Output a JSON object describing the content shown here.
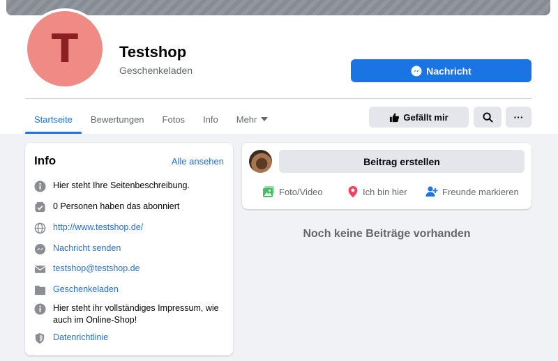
{
  "page": {
    "avatar_letter": "T",
    "title": "Testshop",
    "category": "Geschenkeladen"
  },
  "actions": {
    "message_label": "Nachricht",
    "like_label": "Gefällt mir",
    "more_label": "···"
  },
  "tabs": [
    {
      "label": "Startseite",
      "active": true
    },
    {
      "label": "Bewertungen"
    },
    {
      "label": "Fotos"
    },
    {
      "label": "Info"
    },
    {
      "label": "Mehr"
    }
  ],
  "info": {
    "title": "Info",
    "see_all": "Alle ansehen",
    "items": [
      {
        "icon": "info-icon",
        "text": "Hier steht Ihre Seitenbeschreibung."
      },
      {
        "icon": "subscribe-icon",
        "text": "0 Personen haben das abonniert"
      },
      {
        "icon": "globe-icon",
        "text": "http://www.testshop.de/"
      },
      {
        "icon": "messenger-icon",
        "text": "Nachricht senden"
      },
      {
        "icon": "email-icon",
        "text": "testshop@testshop.de"
      },
      {
        "icon": "category-icon",
        "text": "Geschenkeladen"
      },
      {
        "icon": "info-icon",
        "text": "Hier steht ihr vollständiges Impressum, wie auch im Online-Shop!"
      },
      {
        "icon": "shield-icon",
        "text": "Datenrichtlinie"
      }
    ]
  },
  "composer": {
    "create_label": "Beitrag erstellen",
    "photo_video": "Foto/Video",
    "checkin": "Ich bin hier",
    "tag_friends": "Freunde markieren"
  },
  "feed": {
    "empty_message": "Noch keine Beiträge vorhanden"
  },
  "colors": {
    "accent": "#1b74e4",
    "link": "#216fdb",
    "avatar_bg": "#f08a84",
    "avatar_letter": "#8b1f22",
    "photo_icon": "#45bd62",
    "checkin_icon": "#f3425f"
  }
}
